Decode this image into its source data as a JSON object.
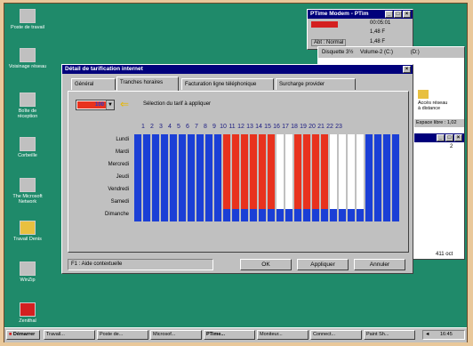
{
  "desktop": {
    "icons": [
      {
        "label": "Poste de travail",
        "icon": "computer-icon"
      },
      {
        "label": "Voisinage réseau",
        "icon": "network-icon"
      },
      {
        "label": "Boîte de réception",
        "icon": "inbox-icon"
      },
      {
        "label": "Corbeille",
        "icon": "recycle-bin-icon"
      },
      {
        "label": "The Microsoft Network",
        "icon": "msn-icon"
      },
      {
        "label": "Travail Denis",
        "icon": "folder-icon"
      },
      {
        "label": "WinZip",
        "icon": "winzip-icon"
      },
      {
        "label": "Zenithal",
        "icon": "app-icon"
      }
    ]
  },
  "ptime": {
    "title": "PTime Modem - PTim",
    "rows": [
      {
        "label": "",
        "value": "00:05:01"
      },
      {
        "label": "",
        "value": "1,48 F"
      },
      {
        "label": "Abt : Normal",
        "value": "1,48 F"
      }
    ]
  },
  "explorer": {
    "disk_label": "Disquette 3½",
    "volume_label": "Volume-2 (C:)",
    "drive_d": "(D:)",
    "free_space": "Espace libre : 1,02",
    "size": "411 oct",
    "side_text": [
      "Accès réseau",
      "à distance"
    ],
    "page_count": "2"
  },
  "dialog": {
    "title": "Détail de tarification internet",
    "close": "×",
    "tabs": [
      "Général",
      "Tranches horaires",
      "Facturation ligne téléphonique",
      "Surcharge provider"
    ],
    "active_tab": 1,
    "tariff_value": "100",
    "tariff_label": "Sélection du tarif à appliquer",
    "hours": [
      "1",
      "2",
      "3",
      "4",
      "5",
      "6",
      "7",
      "8",
      "9",
      "10",
      "11",
      "12",
      "13",
      "14",
      "15",
      "16",
      "17",
      "18",
      "19",
      "20",
      "21",
      "22",
      "23"
    ],
    "days": [
      "Lundi",
      "Mardi",
      "Mercredi",
      "Jeudi",
      "Vendredi",
      "Samedi",
      "Dimanche"
    ],
    "help_text": "F1 : Aide contextuelle",
    "ok_label": "OK",
    "apply_label": "Appliquer",
    "cancel_label": "Annuler",
    "colors": {
      "blue": "#1b3fd6",
      "red": "#e8321e",
      "white": "#ffffff"
    }
  },
  "taskbar": {
    "start_label": "Démarrer",
    "tasks": [
      "Travail...",
      "Poste de...",
      "Microsof...",
      "PTime...",
      "Moniteur...",
      "Connect...",
      "Paint Sh..."
    ],
    "clock": "16:45"
  }
}
